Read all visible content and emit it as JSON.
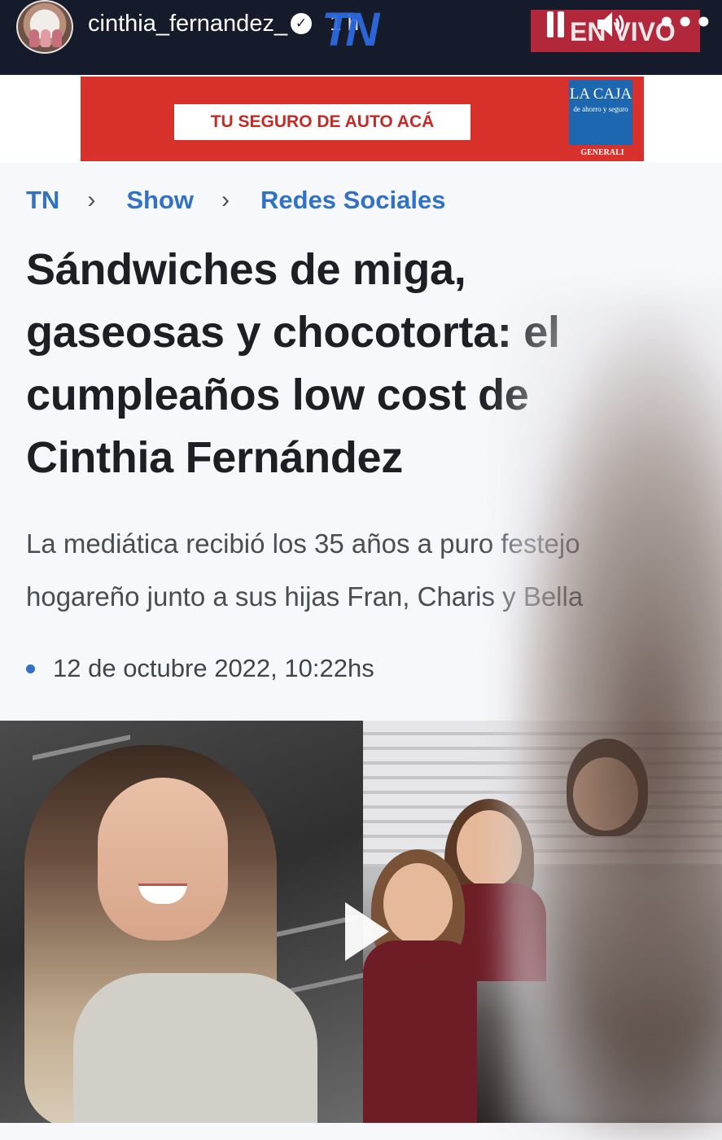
{
  "story": {
    "username": "cinthia_fernandez_",
    "time_ago": "1 h",
    "channel_logo": "TN",
    "live_label": "EN VIVO",
    "controls": [
      "pause-icon",
      "sound-icon",
      "more-icon"
    ]
  },
  "ad": {
    "cta": "TU SEGURO DE AUTO ACÁ",
    "brand": "LA CAJA",
    "brand_tagline": "de ahorro y seguro",
    "partner": "GENERALI"
  },
  "breadcrumb": [
    "TN",
    "Show",
    "Redes Sociales"
  ],
  "article": {
    "headline": "Sándwiches de miga, gaseosas y chocotorta: el cumpleaños low cost de Cinthia Fernández",
    "lead_line1": "La mediática recibió los 35 años a puro festejo",
    "lead_line2": "hogareño junto a sus hijas Fran, Charis y Bella",
    "date": "12 de octubre 2022, 10:22hs"
  },
  "colors": {
    "header_bg": "#151b2b",
    "live_red": "#c42a3c",
    "link_blue": "#3272c4",
    "ad_red": "#d8312b",
    "headline": "#1e1f24"
  }
}
